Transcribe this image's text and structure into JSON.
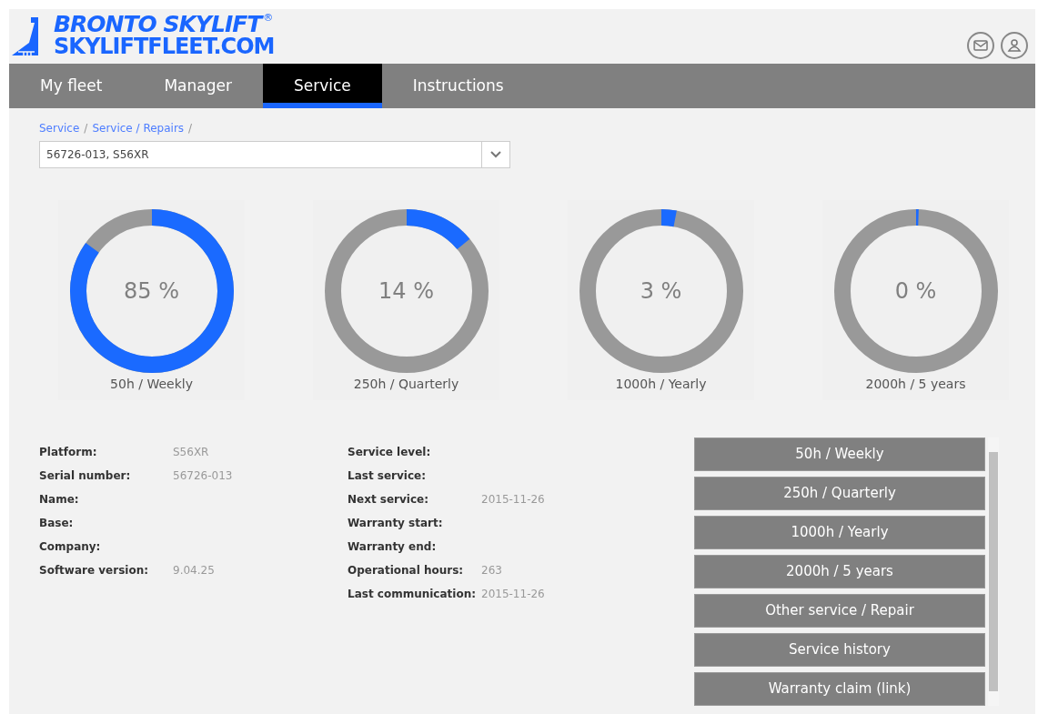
{
  "logo": {
    "line1": "BRONTO SKYLIFT",
    "mark": "®",
    "line2": "SKYLIFTFLEET.COM"
  },
  "tabs": [
    {
      "label": "My fleet",
      "selected": false
    },
    {
      "label": "Manager",
      "selected": false
    },
    {
      "label": "Service",
      "selected": true
    },
    {
      "label": "Instructions",
      "selected": false
    }
  ],
  "breadcrumb": [
    {
      "kind": "link",
      "text": "Service"
    },
    {
      "kind": "separator",
      "text": "/"
    },
    {
      "kind": "link",
      "text": "Service / Repairs"
    },
    {
      "kind": "separator",
      "text": "/"
    }
  ],
  "machine_select": {
    "value": "56726-013, S56XR"
  },
  "gauges": [
    {
      "reading": "85 %",
      "label": "50h / Weekly"
    },
    {
      "reading": "14 %",
      "label": "250h / Quarterly"
    },
    {
      "reading": "3 %",
      "label": "1000h / Yearly"
    },
    {
      "reading": "0 %",
      "label": "2000h / 5 years"
    }
  ],
  "details_left": [
    {
      "label": "Platform:",
      "value": "S56XR"
    },
    {
      "label": "Serial number:",
      "value": "56726-013"
    },
    {
      "label": "Name:"
    },
    {
      "label": "Base:"
    },
    {
      "label": "Company:"
    },
    {
      "label": "Software version:",
      "value": "9.04.25"
    }
  ],
  "details_right": [
    {
      "label": "Service level:"
    },
    {
      "label": "Last service:"
    },
    {
      "label": "Next service:",
      "value": "2015-11-26"
    },
    {
      "label": "Warranty start:"
    },
    {
      "label": "Warranty end:"
    },
    {
      "label": "Operational hours:",
      "value": "263"
    },
    {
      "label": "Last communication:",
      "value": "2015-11-26"
    }
  ],
  "service_buttons": [
    "50h / Weekly",
    "250h / Quarterly",
    "1000h / Yearly",
    "2000h / 5 years",
    "Other service / Repair",
    "Service history",
    "Warranty claim (link)"
  ]
}
